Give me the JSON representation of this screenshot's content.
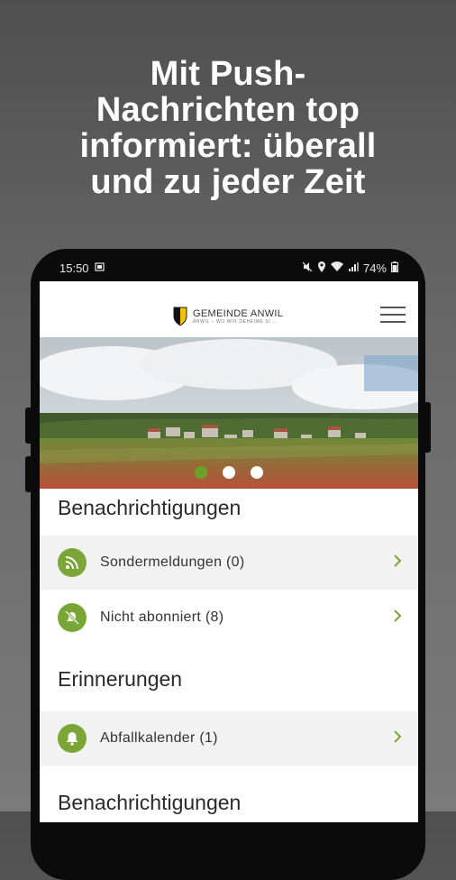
{
  "headline": {
    "line1": "Mit Push-",
    "line2": "Nachrichten top",
    "line3": "informiert: überall",
    "line4": "und zu jeder Zeit"
  },
  "status_bar": {
    "time": "15:50",
    "battery": "74%"
  },
  "app_header": {
    "logo_name": "GEMEINDE ANWIL",
    "logo_tagline": "ANWIL – WO WIR DEHEIME SI …"
  },
  "carousel": {
    "slides": 3,
    "active_index": 0
  },
  "notifications": {
    "title": "Benachrichtigungen",
    "items": [
      {
        "label": "Sondermeldungen (0)",
        "icon": "rss-icon"
      },
      {
        "label": "Nicht abonniert (8)",
        "icon": "bell-off-icon"
      }
    ]
  },
  "reminders": {
    "title": "Erinnerungen",
    "items": [
      {
        "label": "Abfallkalender (1)",
        "icon": "bell-icon"
      }
    ]
  },
  "notifications_2": {
    "title": "Benachrichtigungen"
  },
  "colors": {
    "accent": "#7aa637",
    "active_dot": "#6aa22a"
  }
}
